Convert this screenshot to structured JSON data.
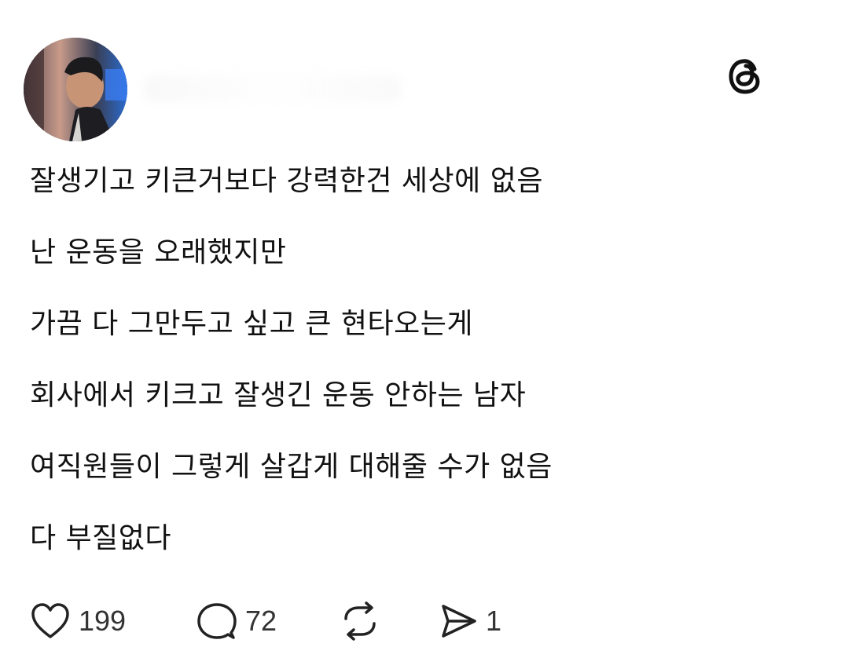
{
  "post": {
    "lines": [
      "잘생기고 키큰거보다 강력한건 세상에 없음",
      "난 운동을 오래했지만",
      "가끔 다 그만두고 싶고 큰 현타오는게",
      "회사에서 키크고 잘생긴 운동 안하는 남자",
      "여직원들이 그렇게 살갑게 대해줄 수가 없음",
      "다 부질없다"
    ]
  },
  "actions": {
    "likes": "199",
    "replies": "72",
    "shares": "1"
  },
  "icons": {
    "logo": "threads-logo-icon",
    "like": "heart-icon",
    "reply": "comment-bubble-icon",
    "repost": "repost-icon",
    "share": "send-icon"
  }
}
